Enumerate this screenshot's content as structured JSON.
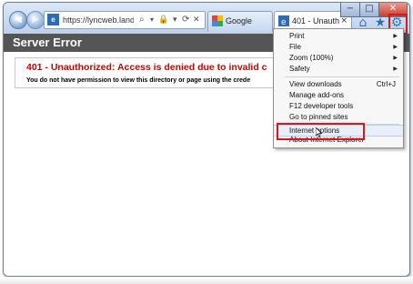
{
  "browser": {
    "address_url": "https://lyncweb.landisc...",
    "address_icons": {
      "search": "⌕",
      "dropdown": "▾",
      "lock": "🔒",
      "refresh": "⟳",
      "stop": "✕"
    },
    "tabs": [
      {
        "label": "Google",
        "favicon": "google-favicon"
      },
      {
        "label": "401 - Unauth...",
        "close": "×",
        "favicon": "ie-favicon"
      }
    ],
    "window_controls": {
      "minimize": "−",
      "maximize": "□",
      "close": "✕"
    },
    "toolbar_icons": {
      "home": "⌂",
      "favorites": "★",
      "tools": "⚙"
    },
    "colors": {
      "highlight": "#e0141b",
      "error_header": "#555555",
      "error_title": "#cc0000"
    }
  },
  "page": {
    "header": "Server Error",
    "error_title": "401 - Unauthorized: Access is denied due to invalid c",
    "error_message": "You do not have permission to view this directory or page using the crede"
  },
  "tools_menu": {
    "items": [
      {
        "label": "Print",
        "submenu": true
      },
      {
        "label": "File",
        "submenu": true
      },
      {
        "label": "Zoom (100%)",
        "submenu": true
      },
      {
        "label": "Safety",
        "submenu": true
      },
      {
        "label": "View downloads",
        "shortcut": "Ctrl+J"
      },
      {
        "label": "Manage add-ons"
      },
      {
        "label": "F12 developer tools"
      },
      {
        "label": "Go to pinned sites"
      },
      {
        "label": "Internet options"
      },
      {
        "label": "About Internet Explorer"
      }
    ]
  }
}
